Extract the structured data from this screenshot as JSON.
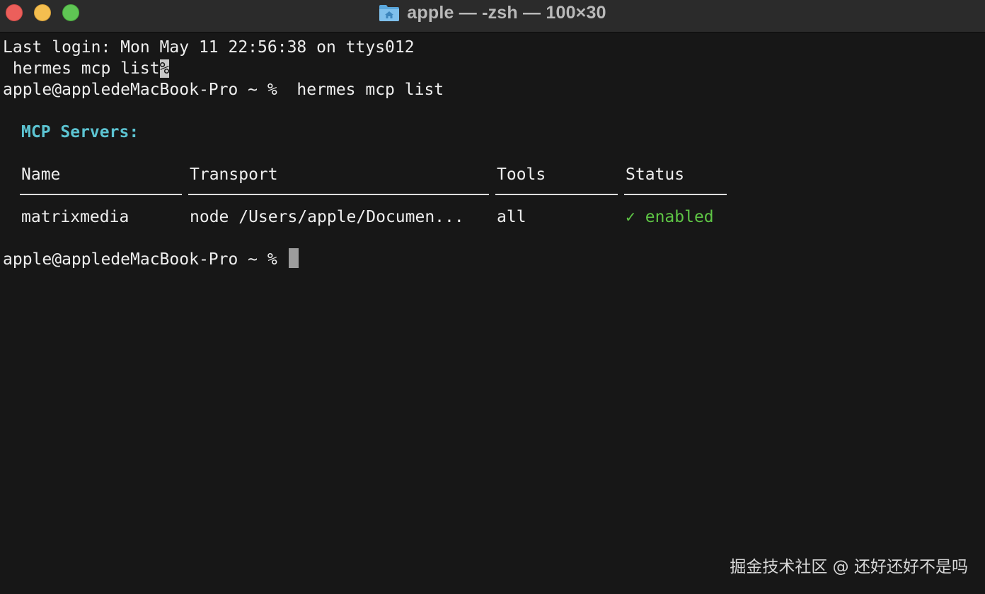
{
  "window": {
    "title": "apple — -zsh — 100×30",
    "icon": "folder-home-icon"
  },
  "terminal": {
    "last_login": "Last login: Mon May 11 22:56:38 on ttys012",
    "echo_command": " hermes mcp list",
    "echo_marker": "%",
    "prompt": "apple@appledeMacBook-Pro ~ % ",
    "command": " hermes mcp list",
    "section_heading": "MCP Servers:",
    "table": {
      "headers": [
        "Name",
        "Transport",
        "Tools",
        "Status"
      ],
      "rows": [
        {
          "name": "matrixmedia",
          "transport": "node /Users/apple/Documen...",
          "tools": "all",
          "status_icon": "✓",
          "status": "enabled"
        }
      ]
    },
    "final_prompt": "apple@appledeMacBook-Pro ~ %"
  },
  "watermark": "掘金技术社区 @ 还好还好不是吗",
  "colors": {
    "background": "#171717",
    "heading": "#5cc4d2",
    "status_enabled": "#5ec545"
  }
}
